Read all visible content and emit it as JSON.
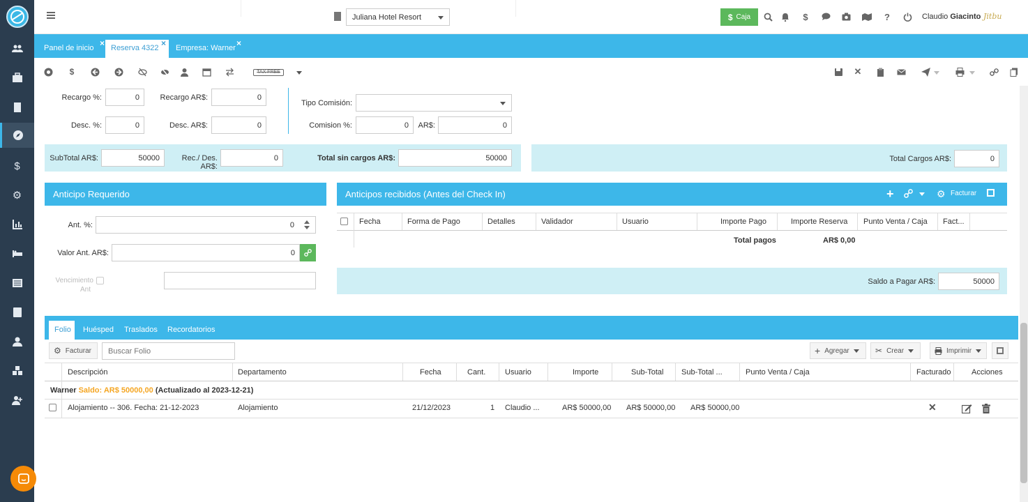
{
  "sidebar": {
    "items": [
      "users-icon",
      "briefcase-icon",
      "building-icon",
      "compass-icon",
      "dollar-icon",
      "settings-icon",
      "chart-icon",
      "bed-icon",
      "list-icon",
      "book-icon",
      "user-icon",
      "cubes-icon",
      "user-plus-icon"
    ]
  },
  "topbar": {
    "hotel": "Juliana Hotel Resort",
    "caja_label": "Caja",
    "user_first": "Claudio",
    "user_last": "Giacinto",
    "signature": "Jitbu"
  },
  "tabs": [
    {
      "label": "Panel de inicio"
    },
    {
      "label": "Reserva 4322"
    },
    {
      "label": "Empresa: Warner"
    }
  ],
  "toolbar": {
    "tax_free": "TAX FREE"
  },
  "charges": {
    "recargo_pct_label": "Recargo %:",
    "recargo_pct": "0",
    "recargo_ars_label": "Recargo AR$:",
    "recargo_ars": "0",
    "desc_pct_label": "Desc. %:",
    "desc_pct": "0",
    "desc_ars_label": "Desc. AR$:",
    "desc_ars": "0",
    "tipo_comision_label": "Tipo Comisión:",
    "tipo_comision": "",
    "comision_pct_label": "Comision %:",
    "comision_pct": "0",
    "comision_ars_label": "AR$:",
    "comision_ars": "0"
  },
  "totals": {
    "subtotal_label": "SubTotal AR$:",
    "subtotal": "50000",
    "recdes_label": "Rec./ Des. AR$:",
    "recdes": "0",
    "total_sin_label": "Total sin cargos AR$:",
    "total_sin": "50000",
    "total_cargos_label": "Total Cargos AR$:",
    "total_cargos": "0"
  },
  "anticipo": {
    "title": "Anticipo Requerido",
    "ant_pct_label": "Ant. %:",
    "ant_pct": "0",
    "valor_label": "Valor Ant. AR$:",
    "valor": "0",
    "venc_label_1": "Vencimiento",
    "venc_label_2": "Ant",
    "venc_value": ""
  },
  "anticipos_recibidos": {
    "title": "Anticipos recibidos (Antes del Check In)",
    "facturar": "Facturar",
    "columns": [
      "Fecha",
      "Forma de Pago",
      "Detalles",
      "Validador",
      "Usuario",
      "Importe Pago",
      "Importe Reserva",
      "Punto Venta / Caja",
      "Fact..."
    ],
    "total_pagos_label": "Total pagos",
    "total_pagos": "AR$ 0,00",
    "saldo_label": "Saldo a Pagar AR$:",
    "saldo": "50000"
  },
  "folio": {
    "tabs": [
      "Folio",
      "Huésped",
      "Traslados",
      "Recordatorios"
    ],
    "facturar": "Facturar",
    "search_placeholder": "Buscar Folio",
    "agregar": "Agregar",
    "crear": "Crear",
    "imprimir": "Imprimir",
    "columns": [
      "Descripción",
      "Departamento",
      "Fecha",
      "Cant.",
      "Usuario",
      "Importe",
      "Sub-Total",
      "Sub-Total ...",
      "Punto Venta / Caja",
      "Facturado",
      "Acciones"
    ],
    "group": {
      "name": "Warner",
      "saldo": "Saldo: AR$ 50000,00",
      "updated": "(Actualizado al 2023-12-21)"
    },
    "rows": [
      {
        "descripcion": "Alojamiento -- 306. Fecha: 21-12-2023",
        "departamento": "Alojamiento",
        "fecha": "21/12/2023",
        "cant": "1",
        "usuario": "Claudio ...",
        "importe": "AR$ 50000,00",
        "subtotal": "AR$ 50000,00",
        "subtotal2": "AR$ 50000,00"
      }
    ]
  },
  "colors": {
    "accent": "#3db7e9",
    "sidebar": "#2b3d4f",
    "cyan_panel": "#cfeff5",
    "caja": "#5cb85c",
    "orange": "#f5a623"
  }
}
